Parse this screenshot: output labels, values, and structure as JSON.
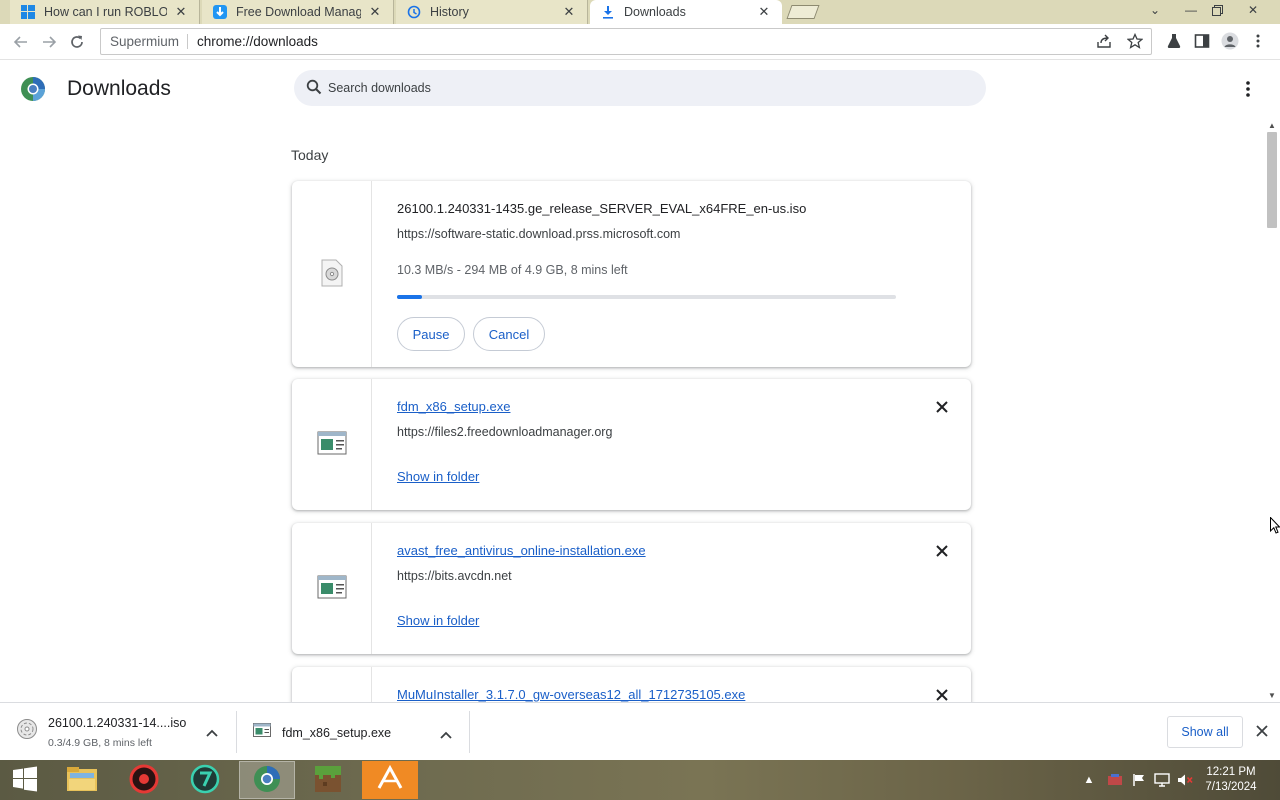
{
  "browser": {
    "tabs": [
      {
        "title": "How can I run ROBLOX",
        "icon": "windows-logo-icon",
        "active": false
      },
      {
        "title": "Free Download Manag",
        "icon": "fdm-icon",
        "active": false
      },
      {
        "title": "History",
        "icon": "history-icon",
        "active": false
      },
      {
        "title": "Downloads",
        "icon": "download-icon",
        "active": true
      }
    ],
    "omnibox": {
      "chip": "Supermium",
      "url": "chrome://downloads"
    }
  },
  "page": {
    "title": "Downloads",
    "search_placeholder": "Search downloads",
    "section": "Today"
  },
  "downloads": [
    {
      "name": "26100.1.240331-1435.ge_release_SERVER_EVAL_x64FRE_en-us.iso",
      "url": "https://software-static.download.prss.microsoft.com",
      "status": "10.3 MB/s - 294 MB of 4.9 GB, 8 mins left",
      "progress": 0.05,
      "pause_label": "Pause",
      "cancel_label": "Cancel"
    },
    {
      "name": "fdm_x86_setup.exe",
      "url": "https://files2.freedownloadmanager.org",
      "folder_label": "Show in folder"
    },
    {
      "name": "avast_free_antivirus_online-installation.exe",
      "url": "https://bits.avcdn.net",
      "folder_label": "Show in folder"
    },
    {
      "name": "MuMuInstaller_3.1.7.0_gw-overseas12_all_1712735105.exe"
    }
  ],
  "shelf": {
    "items": [
      {
        "name": "26100.1.240331-14....iso",
        "status": "0.3/4.9 GB, 8 mins left"
      },
      {
        "name": "fdm_x86_setup.exe"
      }
    ],
    "show_all": "Show all"
  },
  "taskbar": {
    "time": "12:21 PM",
    "date": "7/13/2024"
  },
  "colors": {
    "accent": "#1a73e8",
    "link": "#1a5fc8",
    "search_bg": "#eef0f6"
  }
}
